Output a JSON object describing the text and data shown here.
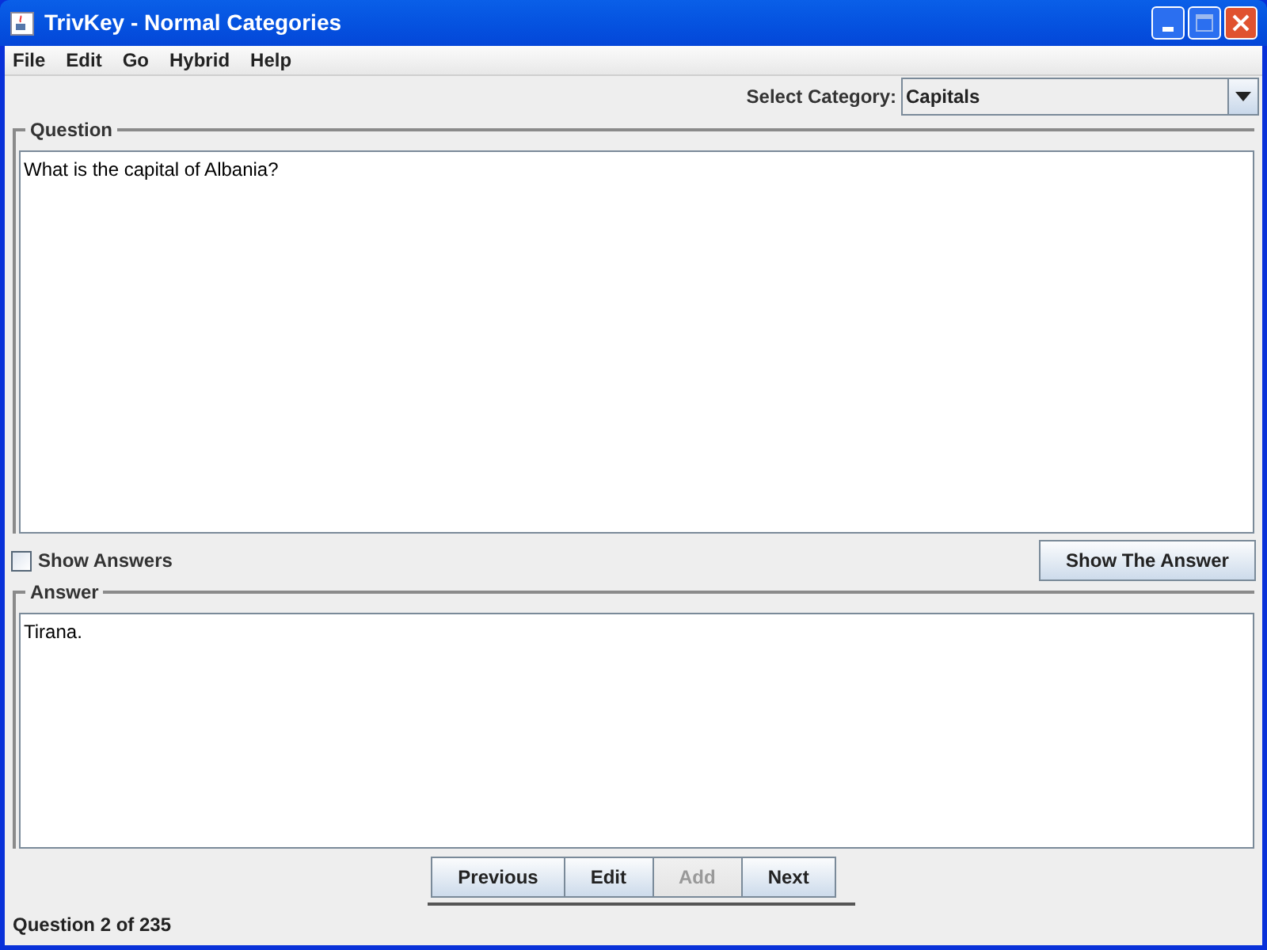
{
  "window": {
    "title": "TrivKey - Normal Categories"
  },
  "menu": [
    "File",
    "Edit",
    "Go",
    "Hybrid",
    "Help"
  ],
  "category": {
    "label": "Select Category:",
    "value": "Capitals"
  },
  "question": {
    "legend": "Question",
    "text": "What is the capital of Albania?"
  },
  "show_answers": {
    "label": "Show Answers",
    "checked": false
  },
  "show_answer_button": "Show The Answer",
  "answer": {
    "legend": "Answer",
    "text": "Tirana."
  },
  "nav_buttons": [
    {
      "label": "Previous",
      "disabled": false
    },
    {
      "label": "Edit",
      "disabled": false
    },
    {
      "label": "Add",
      "disabled": true
    },
    {
      "label": "Next",
      "disabled": false
    }
  ],
  "status_bar": "Question 2 of 235"
}
